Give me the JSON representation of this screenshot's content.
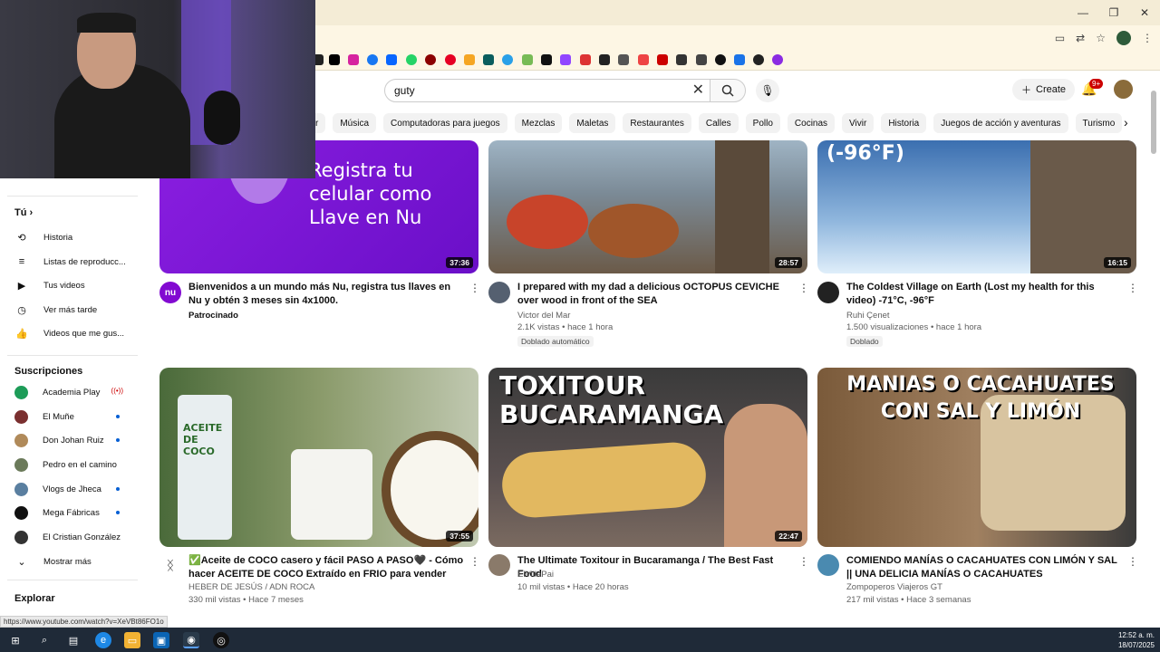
{
  "search": {
    "query": "guty"
  },
  "header": {
    "create_label": "Create",
    "notif_badge": "9+"
  },
  "chips": [
    "r",
    "Música",
    "Computadoras para juegos",
    "Mezclas",
    "Maletas",
    "Restaurantes",
    "Calles",
    "Pollo",
    "Cocinas",
    "Vivir",
    "Historia",
    "Juegos de acción y aventuras",
    "Turismo"
  ],
  "sidebar": {
    "you_label": "Tú",
    "you_items": [
      "Historia",
      "Listas de reproducc...",
      "Tus videos",
      "Ver más tarde",
      "Videos que me gus..."
    ],
    "subs_label": "Suscripciones",
    "subs": [
      "Academia Play",
      "El Muñe",
      "Don Johan Ruiz",
      "Pedro en el camino",
      "Vlogs de Jheca",
      "Mega Fábricas",
      "El Cristian González"
    ],
    "show_more": "Mostrar más",
    "explore_label": "Explorar"
  },
  "videos": [
    {
      "title": "Bienvenidos a un mundo más Nu, registra tus llaves en Nu y obtén 3 meses sin 4x1000.",
      "channel": "Patrocinado",
      "meta": "",
      "duration": "37:36",
      "thumb_text": "Registra tu celular como Llave en Nu",
      "channel_avatar_text": "nu"
    },
    {
      "title": "I prepared with my dad a delicious OCTOPUS CEVICHE over wood in front of the SEA",
      "channel": "Victor del Mar",
      "meta": "2.1K vistas • hace 1 hora",
      "duration": "28:57",
      "tag": "Doblado automático"
    },
    {
      "title": "The Coldest Village on Earth (Lost my health for this video) -71°C, -96°F",
      "channel": "Ruhi Çenet",
      "meta": "1.500 visualizaciones • hace 1 hora",
      "duration": "16:15",
      "tag": "Doblado",
      "thumb_text": "(-96°F)"
    },
    {
      "title": "✅Aceite de COCO casero y fácil PASO A PASO🖤 - Cómo hacer ACEITE DE COCO Extraído en FRIO para vender",
      "channel": "HEBER DE JESÚS / ADN ROCA",
      "meta": "330 mil vistas • Hace 7 meses",
      "duration": "37:55",
      "thumb_text": "ACEITE DE COCO"
    },
    {
      "title": "The Ultimate Toxitour in Bucaramanga / The Best Fast Food",
      "channel": "ElVillaPai",
      "meta": "10 mil vistas • Hace 20 horas",
      "duration": "22:47",
      "thumb_text": "TOXITOUR BUCARAMANGA"
    },
    {
      "title": "COMIENDO MANÍAS O CACAHUATES CON LIMÓN Y SAL || UNA DELICIA MANÍAS O CACAHUATES",
      "channel": "Zompoperos Viajeros GT",
      "meta": "217 mil vistas • Hace 3 semanas",
      "duration": "",
      "thumb_text": "MANIAS O CACAHUATES CON SAL Y LIMÓN"
    }
  ],
  "status_url": "https://www.youtube.com/watch?v=XeVBt86FO1o",
  "clock": {
    "time": "12:52 a. m.",
    "date": "18/07/2025"
  },
  "colors": {
    "accent": "#065fd4",
    "thumb_purple": "#7b16d6",
    "taskbar": "#1f2a38"
  }
}
